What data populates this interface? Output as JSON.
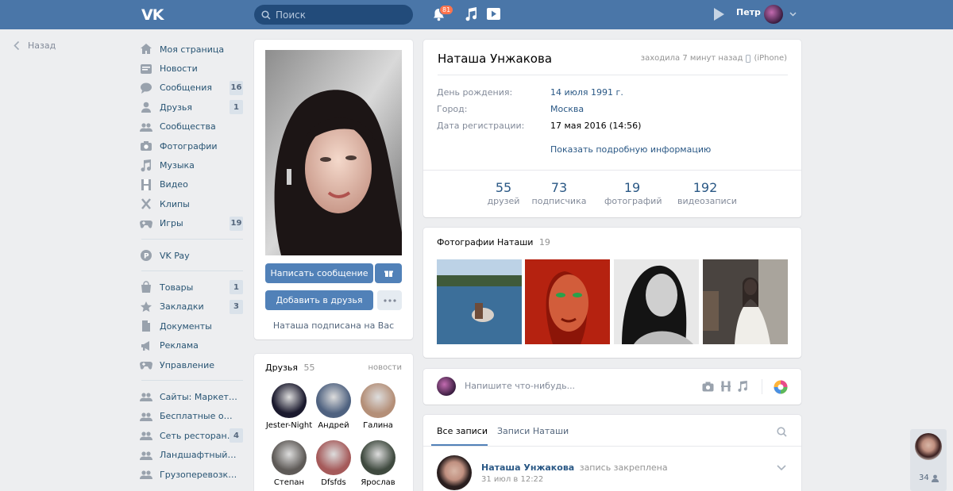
{
  "topbar": {
    "logo": "VK",
    "search_placeholder": "Поиск",
    "notifications_count": "81",
    "user_name": "Петр"
  },
  "back_label": "Назад",
  "sidebar": {
    "main": [
      {
        "label": "Моя страница",
        "icon": "home-icon",
        "count": ""
      },
      {
        "label": "Новости",
        "icon": "news-icon",
        "count": ""
      },
      {
        "label": "Сообщения",
        "icon": "messages-icon",
        "count": "16"
      },
      {
        "label": "Друзья",
        "icon": "friends-icon",
        "count": "1"
      },
      {
        "label": "Сообщества",
        "icon": "communities-icon",
        "count": ""
      },
      {
        "label": "Фотографии",
        "icon": "camera-icon",
        "count": ""
      },
      {
        "label": "Музыка",
        "icon": "music-icon",
        "count": ""
      },
      {
        "label": "Видео",
        "icon": "video-icon",
        "count": ""
      },
      {
        "label": "Клипы",
        "icon": "clips-icon",
        "count": ""
      },
      {
        "label": "Игры",
        "icon": "gamepad-icon",
        "count": "19"
      }
    ],
    "pay": [
      {
        "label": "VK Pay",
        "icon": "vkpay-icon",
        "count": ""
      }
    ],
    "extra": [
      {
        "label": "Товары",
        "icon": "bag-icon",
        "count": "1"
      },
      {
        "label": "Закладки",
        "icon": "star-icon",
        "count": "3"
      },
      {
        "label": "Документы",
        "icon": "document-icon",
        "count": ""
      },
      {
        "label": "Реклама",
        "icon": "megaphone-icon",
        "count": ""
      },
      {
        "label": "Управление",
        "icon": "gamepad-icon",
        "count": ""
      }
    ],
    "groups": [
      {
        "label": "Сайты: Маркети...",
        "icon": "group-icon",
        "count": ""
      },
      {
        "label": "Бесплатные объя...",
        "icon": "group-icon",
        "count": ""
      },
      {
        "label": "Сеть ресторано...",
        "icon": "group-icon",
        "count": "4"
      },
      {
        "label": "Ландшафтный диз...",
        "icon": "group-icon",
        "count": ""
      },
      {
        "label": "Грузоперевозки С...",
        "icon": "group-icon",
        "count": ""
      }
    ]
  },
  "profile_actions": {
    "message_button": "Написать сообщение",
    "add_friend_button": "Добавить в друзья",
    "subscribed_note": "Наташа подписана на Вас"
  },
  "friends_block": {
    "title": "Друзья",
    "count": "55",
    "news_link": "новости",
    "items": [
      {
        "name": "Jester-Night",
        "color": "#1b1a2e"
      },
      {
        "name": "Андрей",
        "color": "#4f6280"
      },
      {
        "name": "Галина",
        "color": "#b48f78"
      },
      {
        "name": "Степан",
        "color": "#5e5a57"
      },
      {
        "name": "Dfsfds",
        "color": "#a55a5a"
      },
      {
        "name": "Ярослав",
        "color": "#3f4a3f"
      }
    ]
  },
  "info": {
    "name": "Наташа Унжакова",
    "last_seen": "заходила 7 минут назад",
    "device": "(iPhone)",
    "rows": [
      {
        "label": "День рождения:",
        "value": "14 июля 1991 г.",
        "link": true
      },
      {
        "label": "Город:",
        "value": "Москва",
        "link": true
      },
      {
        "label": "Дата регистрации:",
        "value": "17 мая 2016 (14:56)",
        "link": false
      }
    ],
    "more_link": "Показать подробную информацию",
    "stats": [
      {
        "n": "55",
        "t": "друзей"
      },
      {
        "n": "73",
        "t": "подписчика"
      },
      {
        "n": "19",
        "t": "фотографий"
      },
      {
        "n": "192",
        "t": "видеозаписи"
      }
    ]
  },
  "photos": {
    "title": "Фотографии Наташи",
    "count": "19"
  },
  "composer": {
    "placeholder": "Напишите что-нибудь..."
  },
  "wall": {
    "tab_all": "Все записи",
    "tab_own": "Записи Наташи",
    "post_author": "Наташа Унжакова",
    "post_note": "запись закреплена",
    "post_date": "31 июл в 12:22"
  },
  "chat_widget": {
    "count": "34"
  }
}
